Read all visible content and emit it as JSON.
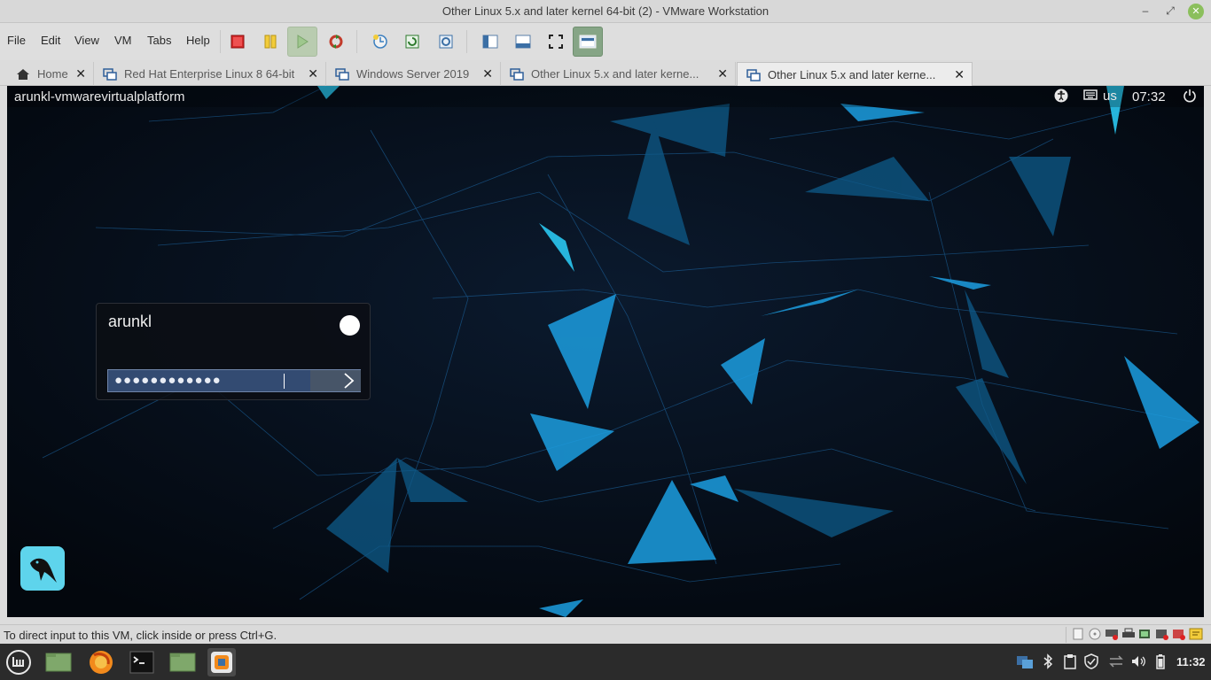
{
  "window": {
    "title": "Other Linux 5.x and later kernel 64-bit (2) - VMware Workstation",
    "minimize": "–",
    "maximize": "⤢",
    "close": "✕"
  },
  "menu": {
    "file": "File",
    "edit": "Edit",
    "view": "View",
    "vm": "VM",
    "tabs": "Tabs",
    "help": "Help"
  },
  "toolbar_icons": [
    "power-off-icon",
    "suspend-icon",
    "power-on-icon",
    "revert-snapshot-icon",
    "snapshot-icon",
    "snapshot-manager-icon",
    "manage-snapshots-icon",
    "library-icon",
    "console-view-icon",
    "fullscreen-icon",
    "unity-icon"
  ],
  "tabs": [
    {
      "label": "Home",
      "icon": "home-icon",
      "close": "✕"
    },
    {
      "label": "Red Hat Enterprise Linux 8 64-bit",
      "icon": "vm-icon",
      "close": "✕"
    },
    {
      "label": "Windows Server 2019",
      "icon": "vm-icon",
      "close": "✕"
    },
    {
      "label": "Other Linux 5.x and later kerne...",
      "icon": "vm-icon",
      "close": "✕"
    },
    {
      "label": "Other Linux 5.x and later kerne...",
      "icon": "vm-icon",
      "close": "✕",
      "active": true
    }
  ],
  "vm": {
    "hostname": "arunkl-vmwarevirtualplatform",
    "layout": "us",
    "time": "07:32",
    "login": {
      "username": "arunkl",
      "password_mask": "●●●●●●●●●●●●",
      "submit_icon": "chevron-right-icon"
    }
  },
  "status": {
    "text": "To direct input to this VM, click inside or press Ctrl+G.",
    "device_icons": [
      "hdd-icon",
      "cd-icon",
      "network-icon",
      "printer-icon",
      "usb-icon",
      "sound-icon",
      "display-icon",
      "message-icon"
    ]
  },
  "taskbar": {
    "apps": [
      "mint-menu-icon",
      "files-icon",
      "firefox-icon",
      "terminal-icon",
      "home-folder-icon",
      "vmware-icon"
    ],
    "tray": [
      "network-tray-icon",
      "bluetooth-icon",
      "clipboard-icon",
      "shield-icon",
      "arrows-icon",
      "volume-icon",
      "battery-icon"
    ],
    "clock": "11:32"
  },
  "colors": {
    "accent_green": "#8bbf5c",
    "vm_bg": "#050a13",
    "pw_field": "#334b72",
    "parrot": "#5ed4ec"
  }
}
